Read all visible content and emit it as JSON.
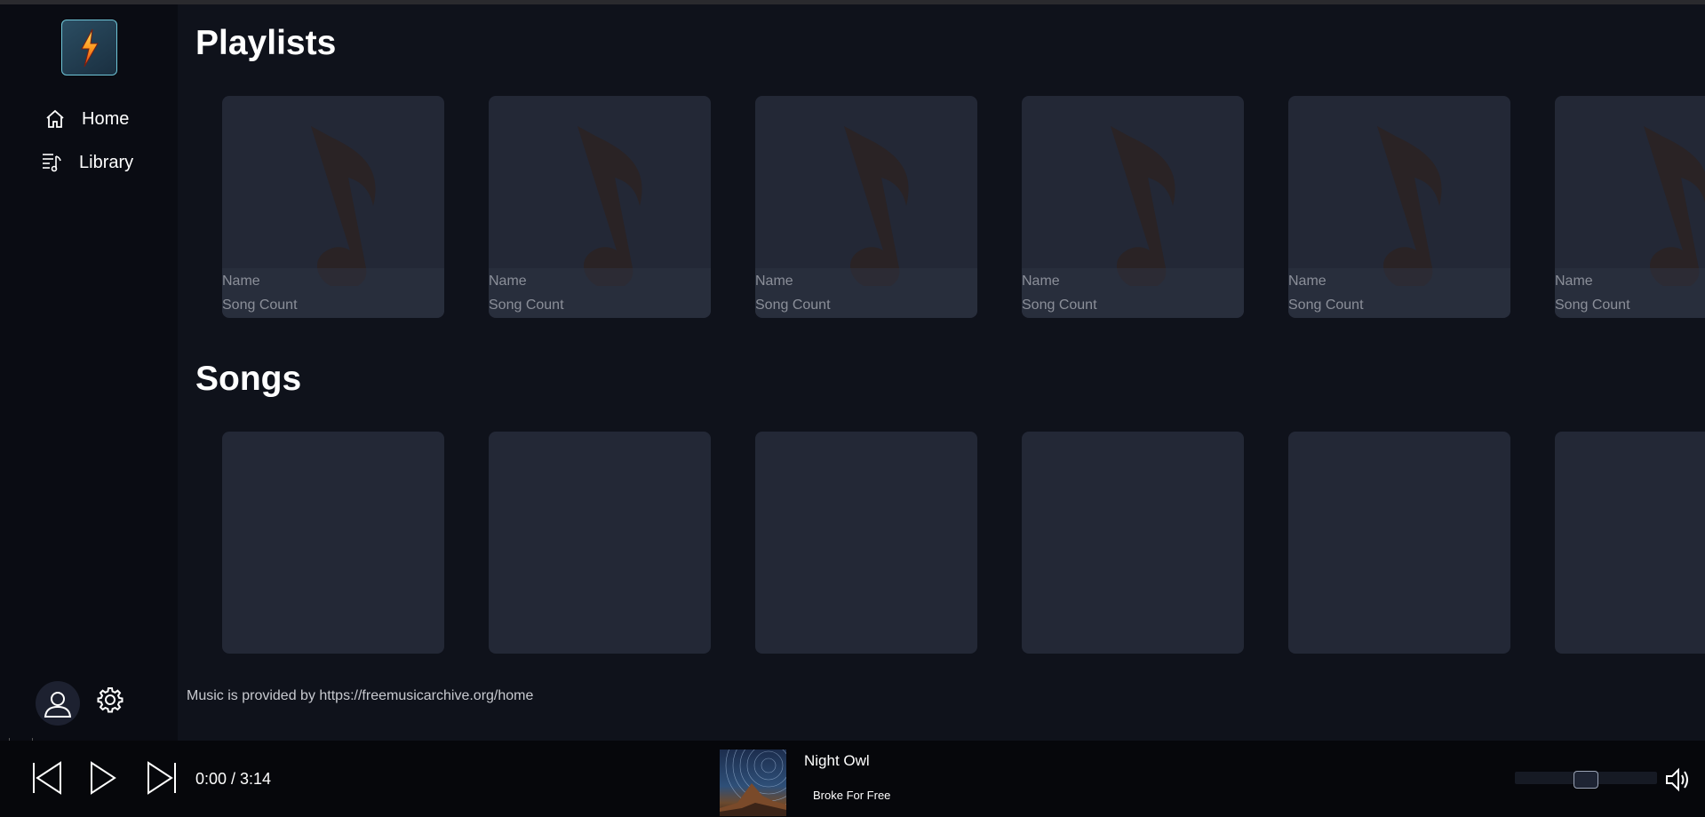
{
  "sidebar": {
    "logo_icon": "lightning-bolt-icon",
    "items": [
      {
        "label": "Home",
        "icon": "home-icon"
      },
      {
        "label": "Library",
        "icon": "playlist-icon"
      }
    ],
    "user_icon": "user-icon",
    "settings_icon": "gear-icon"
  },
  "main": {
    "playlists_title": "Playlists",
    "songs_title": "Songs",
    "playlist_cards": [
      {
        "name": "Name",
        "count": "Song Count"
      },
      {
        "name": "Name",
        "count": "Song Count"
      },
      {
        "name": "Name",
        "count": "Song Count"
      },
      {
        "name": "Name",
        "count": "Song Count"
      },
      {
        "name": "Name",
        "count": "Song Count"
      },
      {
        "name": "Name",
        "count": "Song Count"
      }
    ],
    "song_cards_count": 6,
    "footer_note": "Music is provided by https://freemusicarchive.org/home"
  },
  "player": {
    "time": "0:00 / 3:14",
    "track_title": "Night Owl",
    "track_artist": "Broke For Free",
    "volume_level": 0.5,
    "colors": {
      "background": "#06070b",
      "accent": "#9aa3b5"
    }
  },
  "colors": {
    "page_bg": "#0f121b",
    "sidebar_bg": "#0a0c13",
    "card_bg": "#232836",
    "note_color": "#2a2325"
  }
}
